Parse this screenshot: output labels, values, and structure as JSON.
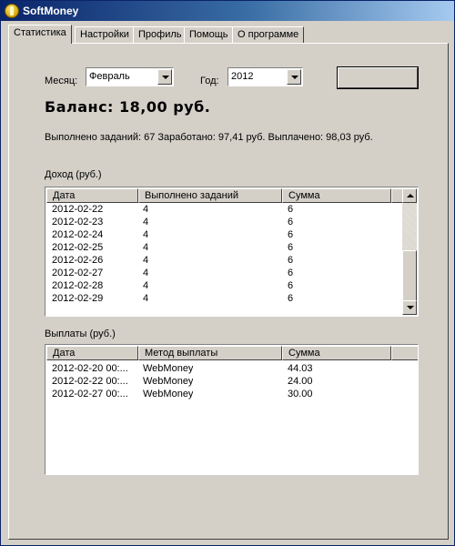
{
  "window": {
    "title": "SoftMoney"
  },
  "tabs": [
    {
      "label": "Статистика"
    },
    {
      "label": "Настройки"
    },
    {
      "label": "Профиль"
    },
    {
      "label": "Помощь"
    },
    {
      "label": "О программе"
    }
  ],
  "filters": {
    "month_label": "Месяц:",
    "month_value": "Февраль",
    "year_label": "Год:",
    "year_value": "2012",
    "action_button_label": ""
  },
  "balance": "Баланс: 18,00 руб.",
  "summary": "Выполнено заданий: 67 Заработано: 97,41 руб. Выплачено: 98,03 руб.",
  "income": {
    "label": "Доход (руб.)",
    "columns": [
      "Дата",
      "Выполнено заданий",
      "Сумма"
    ],
    "rows": [
      [
        "2012-02-22",
        "4",
        "6"
      ],
      [
        "2012-02-23",
        "4",
        "6"
      ],
      [
        "2012-02-24",
        "4",
        "6"
      ],
      [
        "2012-02-25",
        "4",
        "6"
      ],
      [
        "2012-02-26",
        "4",
        "6"
      ],
      [
        "2012-02-27",
        "4",
        "6"
      ],
      [
        "2012-02-28",
        "4",
        "6"
      ],
      [
        "2012-02-29",
        "4",
        "6"
      ]
    ]
  },
  "payouts": {
    "label": "Выплаты (руб.)",
    "columns": [
      "Дата",
      "Метод выплаты",
      "Сумма"
    ],
    "rows": [
      [
        "2012-02-20 00:...",
        "WebMoney",
        "44.03"
      ],
      [
        "2012-02-22 00:...",
        "WebMoney",
        "24.00"
      ],
      [
        "2012-02-27 00:...",
        "WebMoney",
        "30.00"
      ]
    ]
  }
}
